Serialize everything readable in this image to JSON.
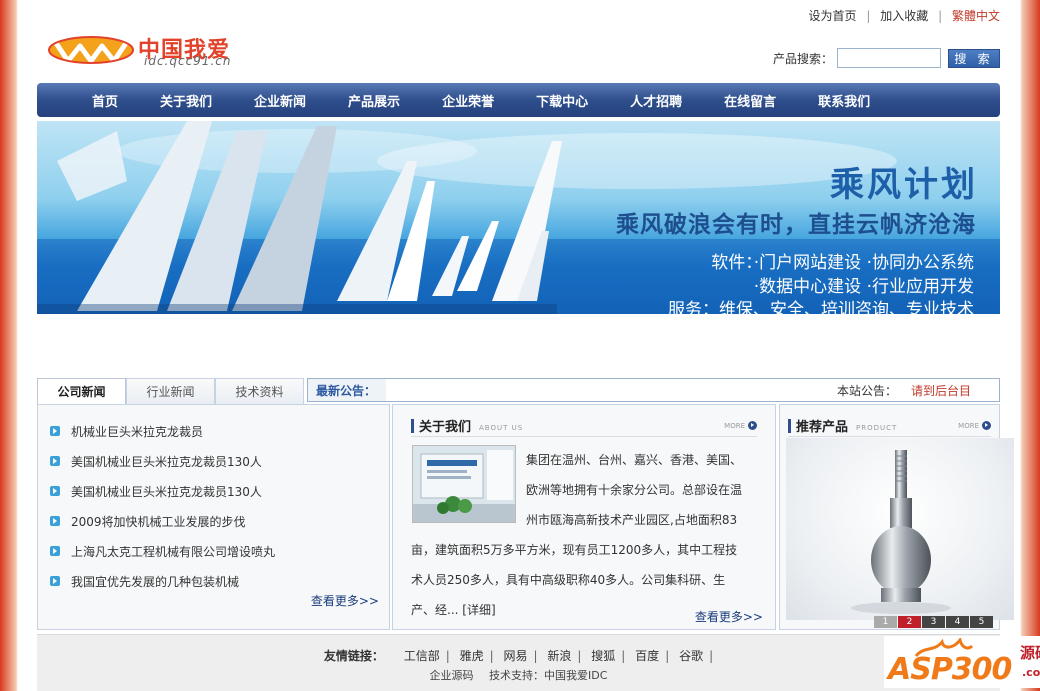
{
  "toplinks": {
    "home": "设为首页",
    "fav": "加入收藏",
    "trad": "繁體中文",
    "sep": "|"
  },
  "logo": {
    "brand": "中国我爱",
    "domain": "idc.qcc91.cn"
  },
  "search": {
    "label": "产品搜索：",
    "placeholder": "",
    "value": "",
    "button": "搜 索"
  },
  "nav": {
    "items": [
      "首页",
      "关于我们",
      "企业新闻",
      "产品展示",
      "企业荣誉",
      "下载中心",
      "人才招聘",
      "在线留言",
      "联系我们"
    ]
  },
  "banner": {
    "title": "乘风计划",
    "subtitle": "乘风破浪会有时，直挂云帆济沧海",
    "line1": "软件：·门户网站建设   ·协同办公系统",
    "line2": "·数据中心建设   ·行业应用开发",
    "line3": "服务：维保、安全、培训咨询、专业技术"
  },
  "tabs": [
    {
      "label": "公司新闻",
      "active": true
    },
    {
      "label": "行业新闻",
      "active": false
    },
    {
      "label": "技术资料",
      "active": false
    }
  ],
  "notice": {
    "label": "最新公告：",
    "site_label": "本站公告：",
    "message": "请到后台目"
  },
  "news": {
    "items": [
      "机械业巨头米拉克龙裁员",
      "美国机械业巨头米拉克龙裁员130人",
      "美国机械业巨头米拉克龙裁员130人",
      "2009将加快机械工业发展的步伐",
      "上海凡太克工程机械有限公司增设喷丸",
      "我国宜优先发展的几种包装机械"
    ],
    "more": "查看更多>>"
  },
  "about": {
    "title": "关于我们",
    "title_en": "ABOUT US",
    "more_icon_label": "MORE",
    "text": "集团在温州、台州、嘉兴、香港、美国、欧洲等地拥有十余家分公司。总部设在温州市瓯海高新技术产业园区,占地面积83亩，建筑面积5万多平方米，现有员工1200多人，其中工程技术人员250多人，具有中高级职称40多人。公司集科研、生产、经... [详细]",
    "more": "查看更多>>"
  },
  "product": {
    "title": "推荐产品",
    "title_en": "PRODUCT",
    "more_icon_label": "MORE",
    "pages": [
      "1",
      "2",
      "3",
      "4",
      "5"
    ],
    "active_page": 2
  },
  "footer": {
    "friend_label": "友情链接：",
    "links": [
      "工信部",
      "雅虎",
      "网易",
      "新浪",
      "搜狐",
      "百度",
      "谷歌"
    ],
    "sep": "|",
    "copy1": "企业源码",
    "copy2": "技术支持：中国我爱IDC"
  },
  "watermark": {
    "main": "ASP300",
    "side1": "源码",
    "side2": ".com"
  },
  "colors": {
    "nav": "#2e4e8c",
    "accent_red": "#c0392b",
    "link_blue": "#1b3d7a",
    "logo_orange": "#f4a11c"
  }
}
